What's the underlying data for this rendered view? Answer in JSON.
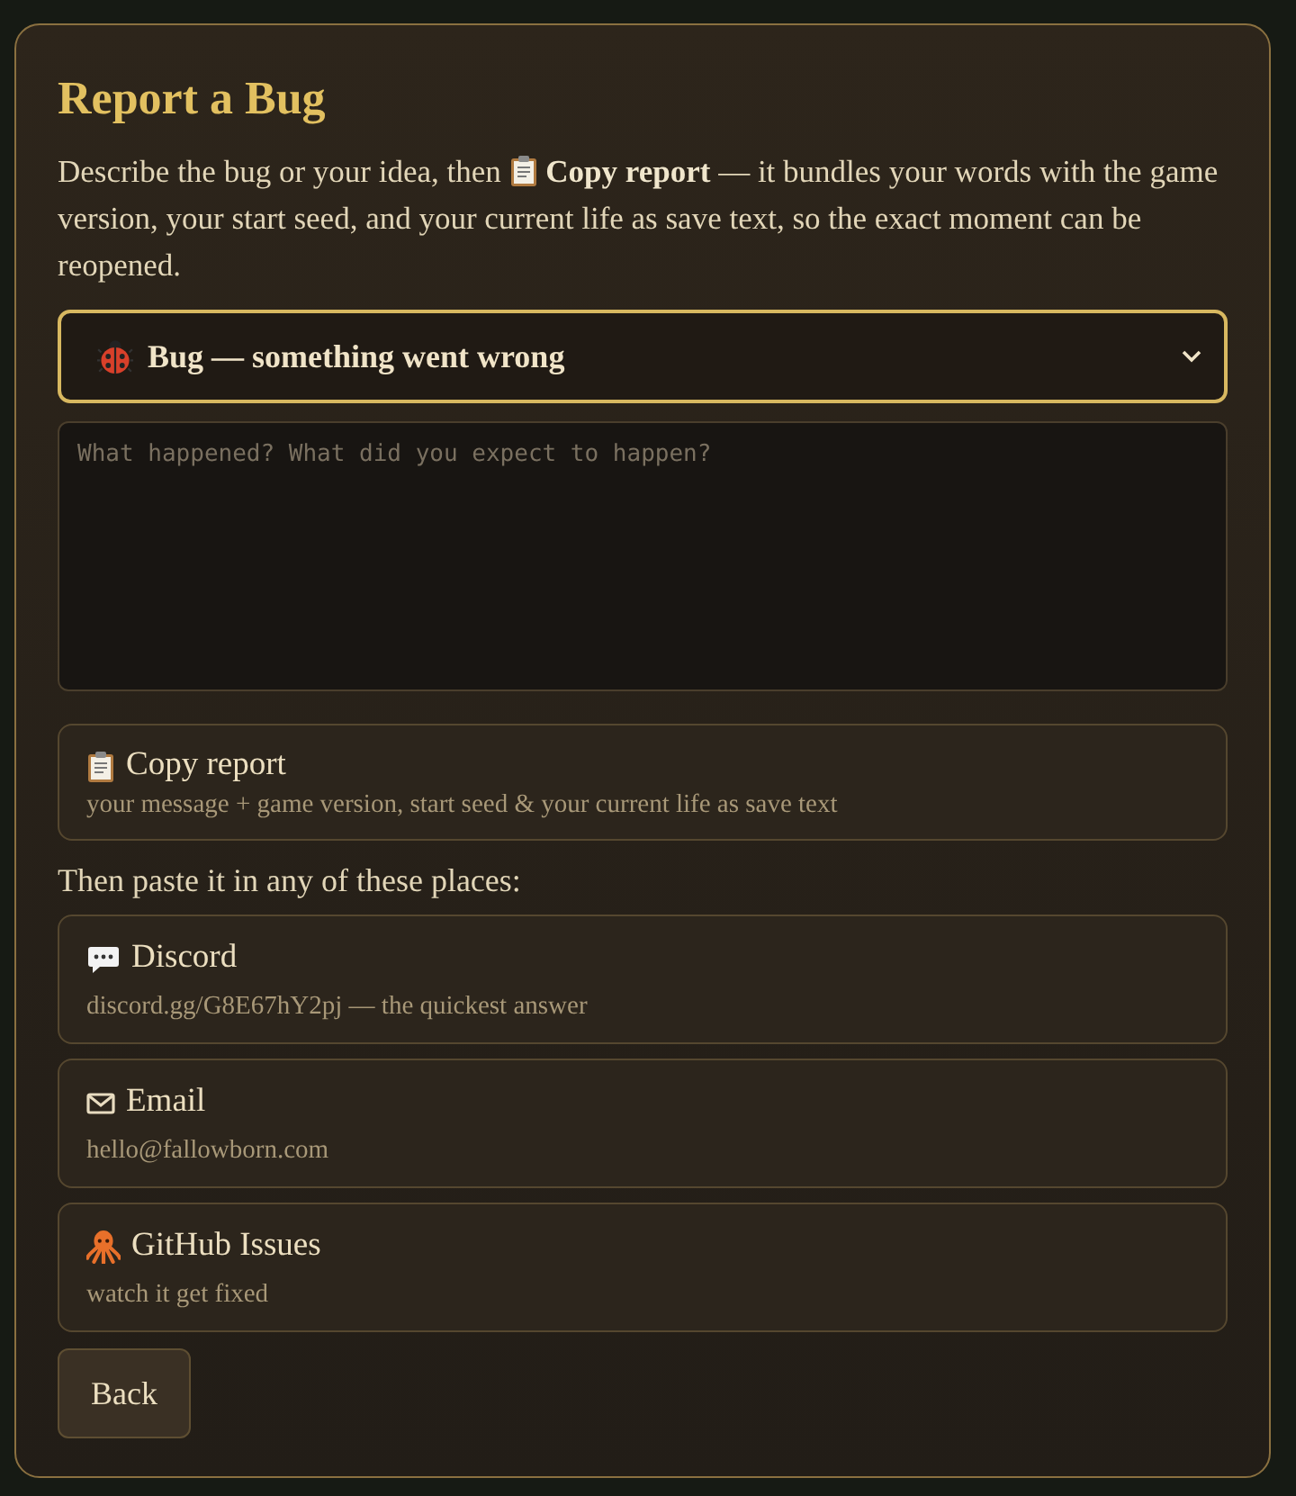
{
  "dialog": {
    "title": "Report a Bug",
    "intro_lead": "Describe the bug or your idea, then",
    "intro_rest": "**Copy report** — it bundles your words with the game version, your start seed, and your current life as save text, so the exact moment can be reopened."
  },
  "category": {
    "value": "Bug — something went wrong"
  },
  "message": {
    "placeholder": "What happened? What did you expect to happen?"
  },
  "copy_button": {
    "label": "Copy report",
    "note": "your message + game version, start seed & your current life as save text"
  },
  "places_heading": "Then paste it in any of these places:",
  "places": [
    {
      "label": "Discord",
      "note": "discord.gg/G8E67hY2pj — the quickest answer"
    },
    {
      "label": "Email",
      "note": "hello@fallowborn.com"
    },
    {
      "label": "GitHub Issues",
      "note": "watch it get fixed"
    }
  ],
  "back_button": "Back"
}
